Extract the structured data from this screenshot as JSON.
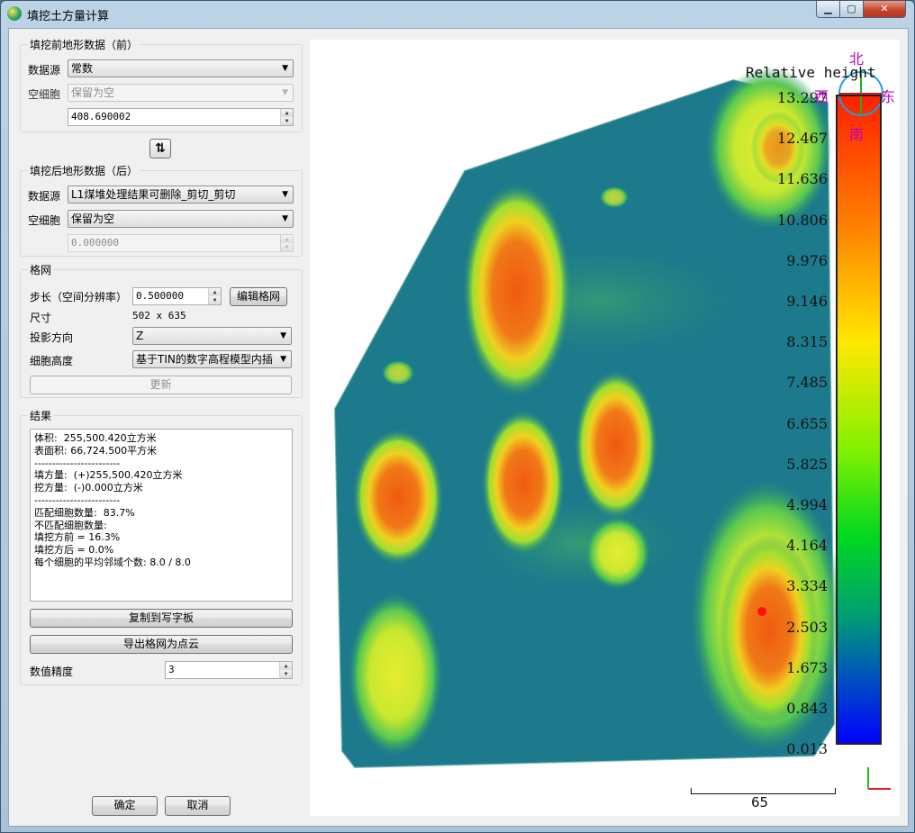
{
  "window": {
    "title": "填挖土方量计算",
    "minimize": "▁",
    "maximize": "▢",
    "close": "✕"
  },
  "before": {
    "group_title": "填挖前地形数据（前）",
    "source_label": "数据源",
    "source_value": "常数",
    "empty_label": "空细胞",
    "empty_value": "保留为空",
    "constant_value": "408.690002"
  },
  "swap_icon": "⇅",
  "after": {
    "group_title": "填挖后地形数据（后）",
    "source_label": "数据源",
    "source_value": "L1煤堆处理结果可删除_剪切_剪切",
    "empty_label": "空细胞",
    "empty_value": "保留为空",
    "constant_value": "0.000000"
  },
  "grid": {
    "group_title": "格网",
    "step_label": "步长（空间分辨率）",
    "step_value": "0.500000",
    "edit_button": "编辑格网",
    "size_label": "尺寸",
    "size_value": "502 x 635",
    "projection_label": "投影方向",
    "projection_value": "Z",
    "height_label": "细胞高度",
    "height_value": "基于TIN的数字高程模型内插",
    "update_button": "更新"
  },
  "results": {
    "group_title": "结果",
    "text": "体积:  255,500.420立方米\n表面积: 66,724.500平方米\n------------------------\n填方量:  (+)255,500.420立方米\n挖方量:  (-)0.000立方米\n------------------------\n匹配细胞数量:  83.7%\n不匹配细胞数量:\n填挖方前 = 16.3%\n填挖方后 = 0.0%\n每个细胞的平均邻域个数: 8.0 / 8.0",
    "copy_button": "复制到写字板",
    "export_button": "导出格网为点云",
    "precision_label": "数值精度",
    "precision_value": "3"
  },
  "footer": {
    "ok_button": "确定",
    "cancel_button": "取消"
  },
  "viewer": {
    "scale_title": "Relative height",
    "ticks": [
      "13.297",
      "12.467",
      "11.636",
      "10.806",
      "9.976",
      "9.146",
      "8.315",
      "7.485",
      "6.655",
      "5.825",
      "4.994",
      "4.164",
      "3.334",
      "2.503",
      "1.673",
      "0.843",
      "0.013"
    ],
    "compass": {
      "north": "北",
      "south": "南",
      "east": "东",
      "west": "西"
    },
    "scale_bar_value": "65",
    "colors": {
      "base": "#1d7a8c",
      "mid": "#3cb85a",
      "high": "#f0e020",
      "peak": "#f06010"
    }
  }
}
